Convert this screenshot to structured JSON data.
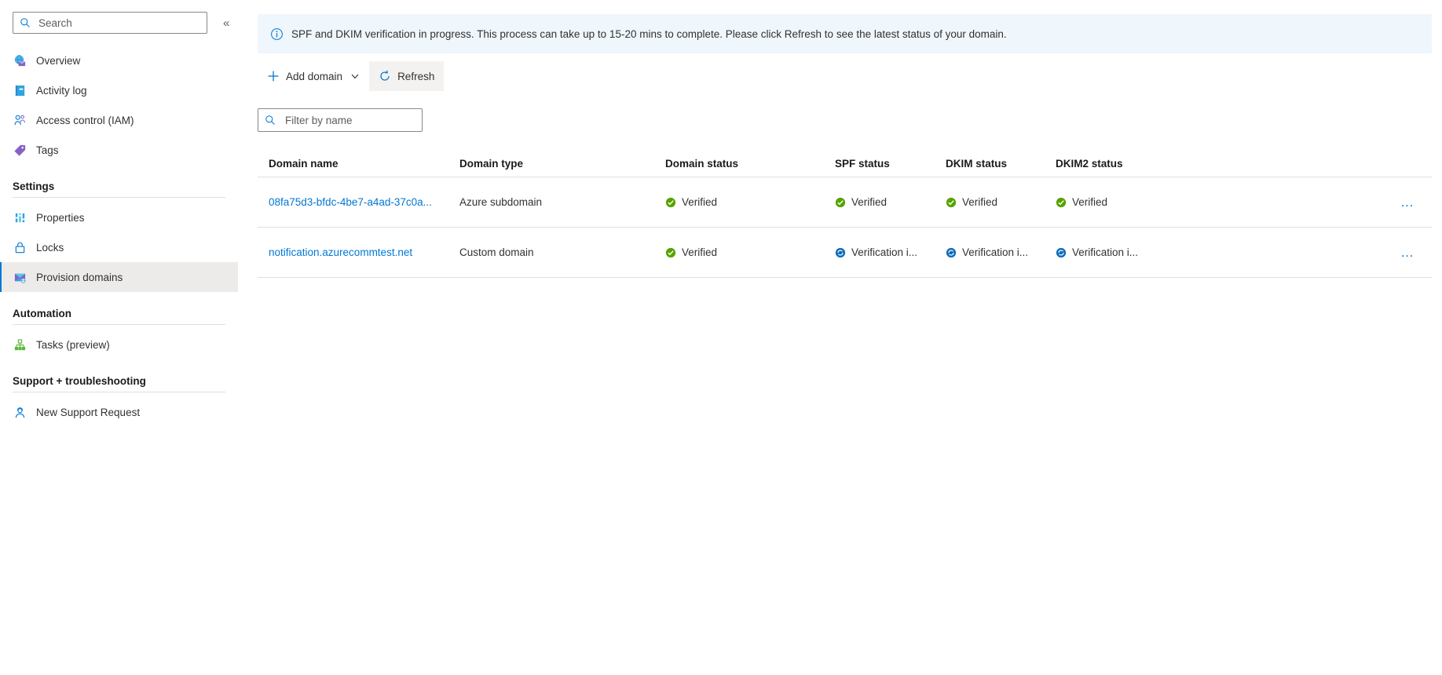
{
  "sidebar": {
    "search": {
      "placeholder": "Search",
      "value": "",
      "icon": "search-icon"
    },
    "collapse_label": "«",
    "items": [
      {
        "label": "Overview",
        "icon": "overview-globe-mail-icon"
      },
      {
        "label": "Activity log",
        "icon": "activity-log-book-icon"
      },
      {
        "label": "Access control (IAM)",
        "icon": "access-control-people-icon"
      },
      {
        "label": "Tags",
        "icon": "tags-icon"
      }
    ],
    "groups": [
      {
        "title": "Settings",
        "items": [
          {
            "label": "Properties",
            "icon": "properties-bars-icon",
            "selected": false
          },
          {
            "label": "Locks",
            "icon": "lock-icon",
            "selected": false
          },
          {
            "label": "Provision domains",
            "icon": "provision-domains-mail-icon",
            "selected": true
          }
        ]
      },
      {
        "title": "Automation",
        "items": [
          {
            "label": "Tasks (preview)",
            "icon": "tasks-hierarchy-icon",
            "selected": false
          }
        ]
      },
      {
        "title": "Support + troubleshooting",
        "items": [
          {
            "label": "New Support Request",
            "icon": "support-person-icon",
            "selected": false
          }
        ]
      }
    ]
  },
  "main": {
    "banner": {
      "icon": "info-circle-icon",
      "text": "SPF and DKIM verification in progress. This process can take up to 15-20 mins to complete. Please click Refresh to see the latest status of your domain.",
      "background": "#eff6fc"
    },
    "toolbar": {
      "add_domain_label": "Add domain",
      "add_domain_icon": "plus-icon",
      "add_domain_caret_icon": "chevron-down-icon",
      "refresh_label": "Refresh",
      "refresh_icon": "refresh-circular-arrow-icon"
    },
    "filter": {
      "placeholder": "Filter by name",
      "value": "",
      "icon": "search-icon"
    },
    "table": {
      "columns": [
        "Domain name",
        "Domain type",
        "Domain status",
        "SPF status",
        "DKIM status",
        "DKIM2 status"
      ],
      "rows": [
        {
          "domain_name": "08fa75d3-bfdc-4be7-a4ad-37c0a...",
          "domain_type": "Azure subdomain",
          "domain_status": {
            "text": "Verified",
            "icon": "verified-check-icon",
            "state": "verified"
          },
          "spf_status": {
            "text": "Verified",
            "icon": "verified-check-icon",
            "state": "verified"
          },
          "dkim_status": {
            "text": "Verified",
            "icon": "verified-check-icon",
            "state": "verified"
          },
          "dkim2_status": {
            "text": "Verified",
            "icon": "verified-check-icon",
            "state": "verified"
          },
          "menu_label": "…"
        },
        {
          "domain_name": "notification.azurecommtest.net",
          "domain_type": "Custom domain",
          "domain_status": {
            "text": "Verified",
            "icon": "verified-check-icon",
            "state": "verified"
          },
          "spf_status": {
            "text": "Verification i...",
            "icon": "in-progress-refresh-icon",
            "state": "in-progress"
          },
          "dkim_status": {
            "text": "Verification i...",
            "icon": "in-progress-refresh-icon",
            "state": "in-progress"
          },
          "dkim2_status": {
            "text": "Verification i...",
            "icon": "in-progress-refresh-icon",
            "state": "in-progress"
          },
          "menu_label": "…"
        }
      ]
    }
  },
  "colors": {
    "link": "#0078d4",
    "verified_green": "#57a300",
    "in_progress_blue": "#0f6cbd",
    "selected_bg": "#edebe9",
    "banner_bg": "#eff6fc"
  }
}
